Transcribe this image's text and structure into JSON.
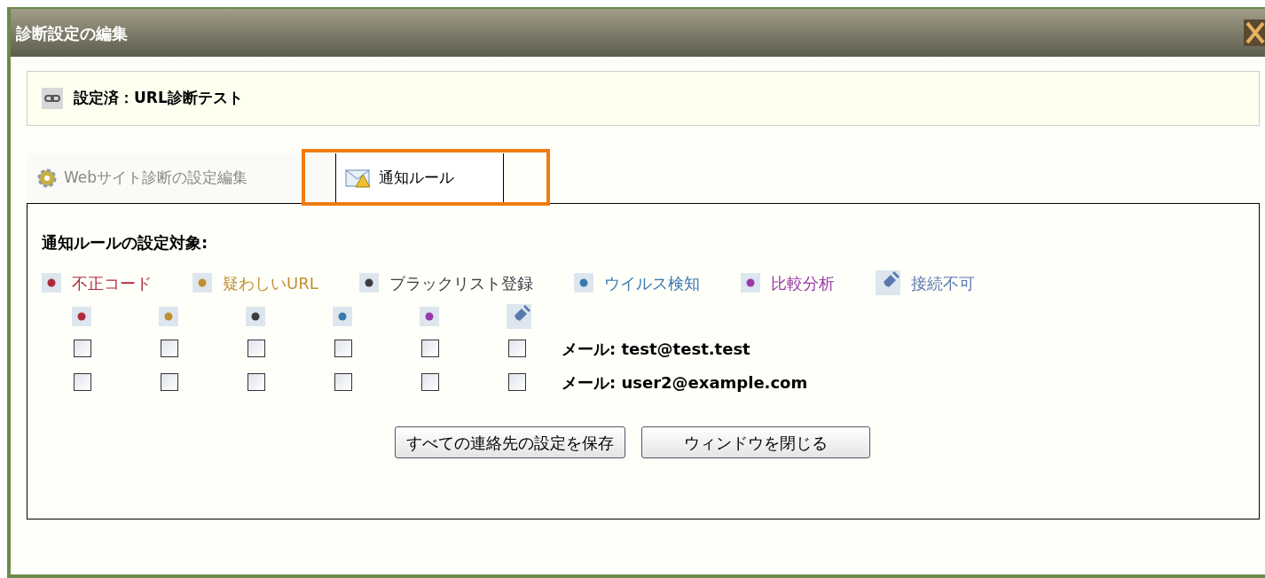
{
  "window": {
    "title": "診断設定の編集"
  },
  "header": {
    "label": "設定済：URL診断テスト"
  },
  "tabs": [
    {
      "label": "Webサイト診断の設定編集",
      "kind": "gear",
      "selected": false
    },
    {
      "label": "通知ルール",
      "kind": "mail",
      "selected": true
    }
  ],
  "section_title": "通知ルールの設定対象:",
  "categories": [
    {
      "label": "不正コード",
      "kind": "dot",
      "color": "#b02a3a"
    },
    {
      "label": "疑わしいURL",
      "kind": "dot",
      "color": "#c09030"
    },
    {
      "label": "ブラックリスト登録",
      "kind": "dot",
      "color": "#3a3e42"
    },
    {
      "label": "ウイルス検知",
      "kind": "dot",
      "color": "#3a78b0"
    },
    {
      "label": "比較分析",
      "kind": "dot",
      "color": "#9a3aa8"
    },
    {
      "label": "接続不可",
      "kind": "plug",
      "color": "#5a78b0"
    }
  ],
  "contacts": [
    {
      "label": "メール:",
      "email": "test@test.test",
      "checks": [
        {
          "checked": false
        },
        {
          "checked": false
        },
        {
          "checked": false
        },
        {
          "checked": false
        },
        {
          "checked": false
        },
        {
          "checked": false
        }
      ]
    },
    {
      "label": "メール:",
      "email": "user2@example.com",
      "checks": [
        {
          "checked": false
        },
        {
          "checked": false
        },
        {
          "checked": false
        },
        {
          "checked": false
        },
        {
          "checked": false
        },
        {
          "checked": false
        }
      ]
    }
  ],
  "buttons": [
    {
      "label": "すべての連絡先の設定を保存"
    },
    {
      "label": "ウィンドウを閉じる"
    }
  ]
}
